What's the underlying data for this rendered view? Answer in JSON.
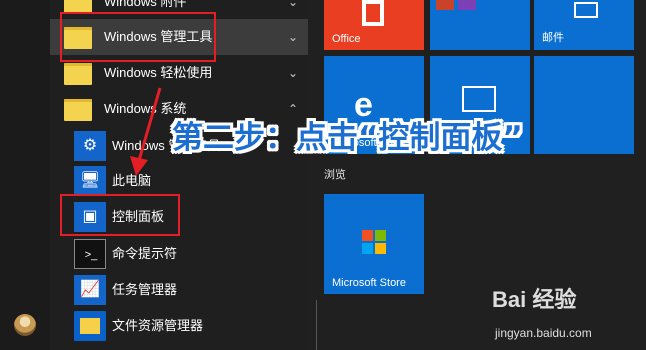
{
  "start_list": {
    "items": [
      {
        "label": "Windows 附件",
        "chevron": "⌄"
      },
      {
        "label": "Windows 管理工具",
        "chevron": "⌄"
      },
      {
        "label": "Windows 轻松使用",
        "chevron": "⌄"
      },
      {
        "label": "Windows 系统",
        "chevron": "⌃"
      },
      {
        "label": "Windows 管理工具"
      },
      {
        "label": "此电脑"
      },
      {
        "label": "控制面板"
      },
      {
        "label": "命令提示符"
      },
      {
        "label": "任务管理器"
      },
      {
        "label": "文件资源管理器"
      }
    ]
  },
  "tiles": {
    "office": "Office",
    "mail": "邮件",
    "edge": "Microsoft Edge",
    "browse_section": "浏览",
    "store": "Microsoft Store"
  },
  "annotation": {
    "text": "第二步：点击“控制面板”"
  },
  "watermark": {
    "logo": "Bai 经验",
    "site": "jingyan.baidu.com"
  },
  "colors": {
    "accent_tile": "#0a6fd1",
    "office_tile": "#ea3e23",
    "highlight_box": "#e31e24",
    "annotation_text": "#1c6fd0",
    "folder": "#f4d34f"
  }
}
